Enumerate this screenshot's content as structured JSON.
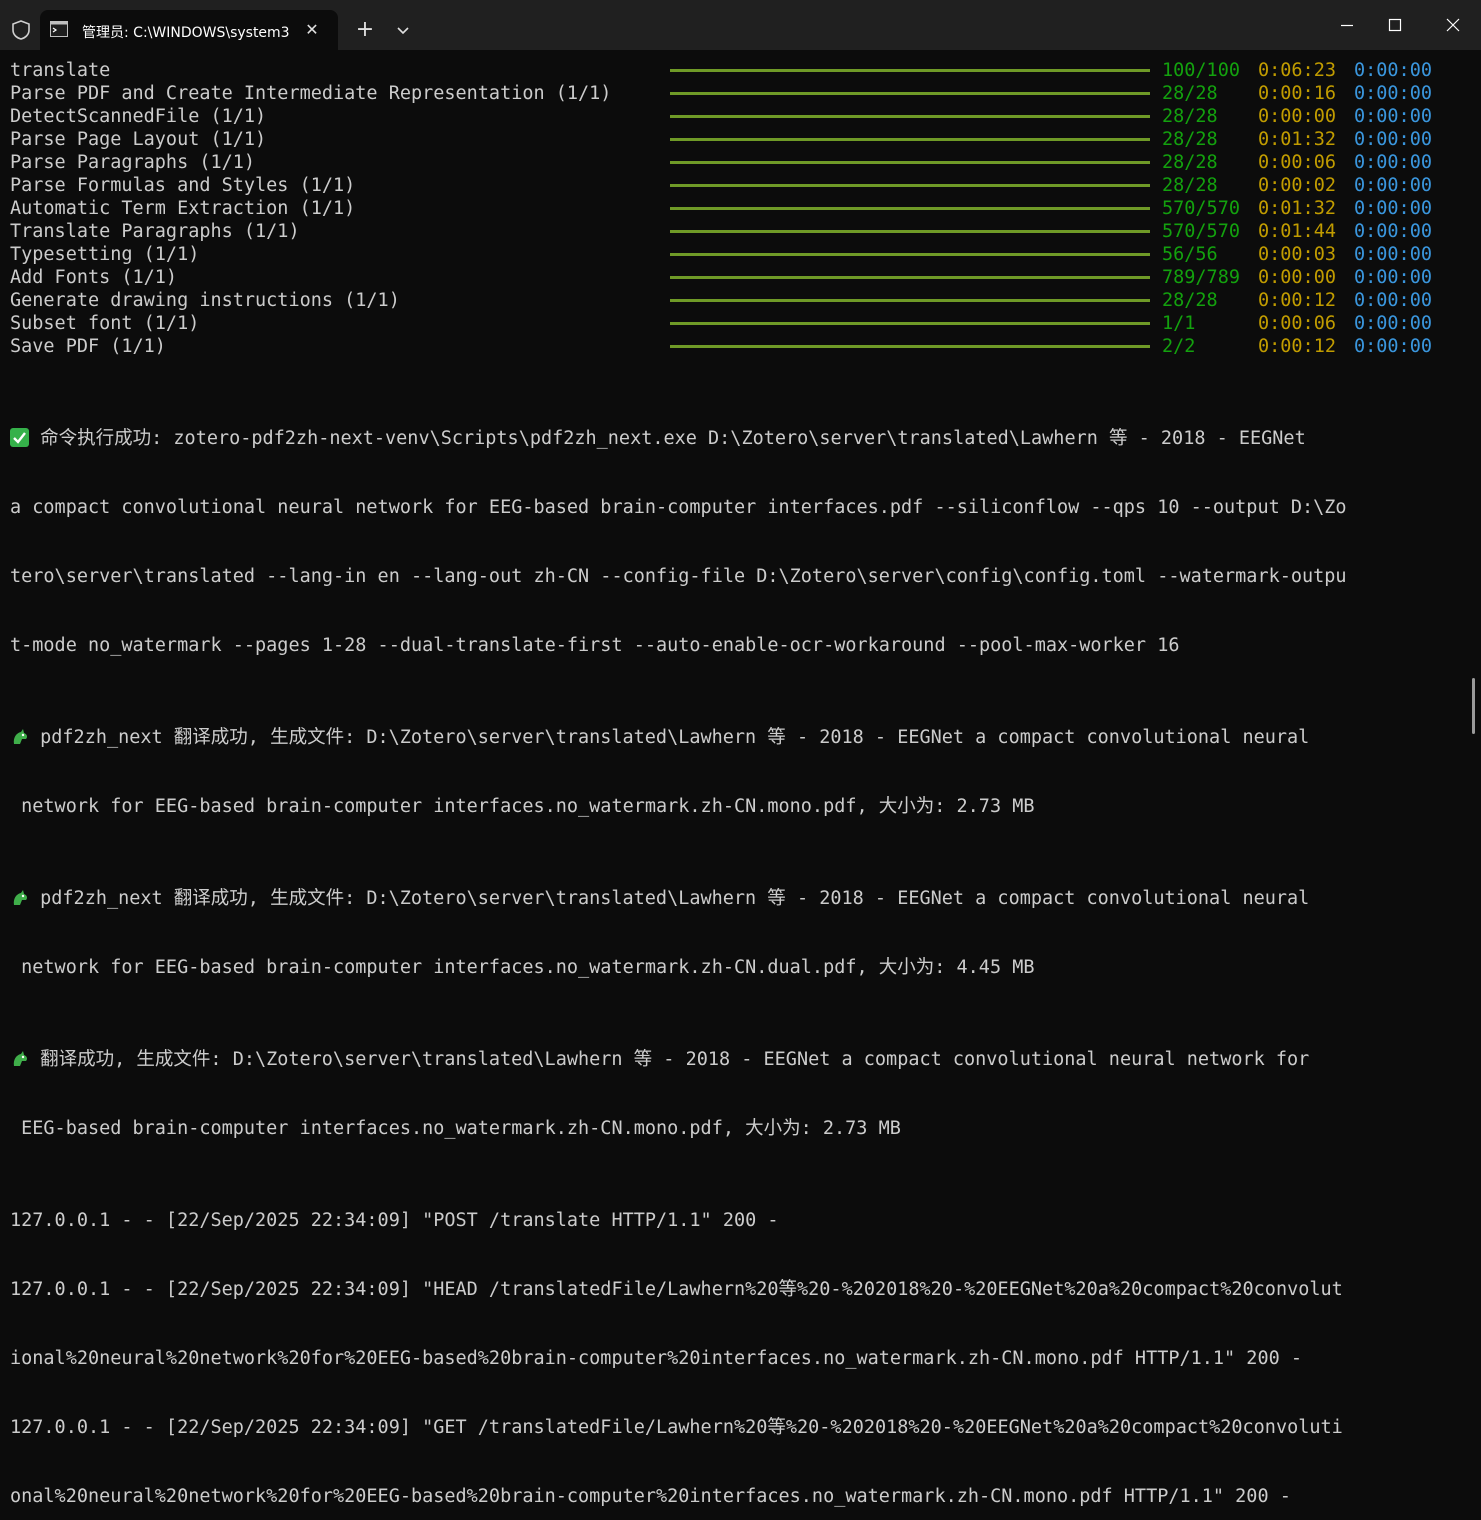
{
  "window": {
    "tab_title": "管理员: C:\\WINDOWS\\system3",
    "tab_close_glyph": "✕",
    "new_tab_glyph": "+"
  },
  "colors": {
    "progress_bar": "#6f9a27",
    "count": "#13a10e",
    "elapsed": "#c19c00",
    "remaining": "#3a96dd"
  },
  "tasks": [
    {
      "label": "translate",
      "progress": 1.0,
      "count": "100/100",
      "elapsed": "0:06:23",
      "remaining": "0:00:00"
    },
    {
      "label": "Parse PDF and Create Intermediate Representation (1/1)",
      "progress": 1.0,
      "count": "28/28",
      "elapsed": "0:00:16",
      "remaining": "0:00:00"
    },
    {
      "label": "DetectScannedFile (1/1)",
      "progress": 1.0,
      "count": "28/28",
      "elapsed": "0:00:00",
      "remaining": "0:00:00"
    },
    {
      "label": "Parse Page Layout (1/1)",
      "progress": 1.0,
      "count": "28/28",
      "elapsed": "0:01:32",
      "remaining": "0:00:00"
    },
    {
      "label": "Parse Paragraphs (1/1)",
      "progress": 1.0,
      "count": "28/28",
      "elapsed": "0:00:06",
      "remaining": "0:00:00"
    },
    {
      "label": "Parse Formulas and Styles (1/1)",
      "progress": 1.0,
      "count": "28/28",
      "elapsed": "0:00:02",
      "remaining": "0:00:00"
    },
    {
      "label": "Automatic Term Extraction (1/1)",
      "progress": 1.0,
      "count": "570/570",
      "elapsed": "0:01:32",
      "remaining": "0:00:00"
    },
    {
      "label": "Translate Paragraphs (1/1)",
      "progress": 1.0,
      "count": "570/570",
      "elapsed": "0:01:44",
      "remaining": "0:00:00"
    },
    {
      "label": "Typesetting (1/1)",
      "progress": 1.0,
      "count": "56/56",
      "elapsed": "0:00:03",
      "remaining": "0:00:00"
    },
    {
      "label": "Add Fonts (1/1)",
      "progress": 1.0,
      "count": "789/789",
      "elapsed": "0:00:00",
      "remaining": "0:00:00"
    },
    {
      "label": "Generate drawing instructions (1/1)",
      "progress": 1.0,
      "count": "28/28",
      "elapsed": "0:00:12",
      "remaining": "0:00:00"
    },
    {
      "label": "Subset font (1/1)",
      "progress": 1.0,
      "count": "1/1",
      "elapsed": "0:00:06",
      "remaining": "0:00:00"
    },
    {
      "label": "Save PDF (1/1)",
      "progress": 1.0,
      "count": "2/2",
      "elapsed": "0:00:12",
      "remaining": "0:00:00"
    }
  ],
  "log": {
    "success": [
      " 命令执行成功: zotero-pdf2zh-next-venv\\Scripts\\pdf2zh_next.exe D:\\Zotero\\server\\translated\\Lawhern 等 - 2018 - EEGNet",
      "a compact convolutional neural network for EEG-based brain-computer interfaces.pdf --siliconflow --qps 10 --output D:\\Zo",
      "tero\\server\\translated --lang-in en --lang-out zh-CN --config-file D:\\Zotero\\server\\config\\config.toml --watermark-outpu",
      "t-mode no_watermark --pages 1-28 --dual-translate-first --auto-enable-ocr-workaround --pool-max-worker 16"
    ],
    "mono": [
      " pdf2zh_next 翻译成功, 生成文件: D:\\Zotero\\server\\translated\\Lawhern 等 - 2018 - EEGNet a compact convolutional neural",
      " network for EEG-based brain-computer interfaces.no_watermark.zh-CN.mono.pdf, 大小为: 2.73 MB"
    ],
    "dual": [
      " pdf2zh_next 翻译成功, 生成文件: D:\\Zotero\\server\\translated\\Lawhern 等 - 2018 - EEGNet a compact convolutional neural",
      " network for EEG-based brain-computer interfaces.no_watermark.zh-CN.dual.pdf, 大小为: 4.45 MB"
    ],
    "final": [
      " 翻译成功, 生成文件: D:\\Zotero\\server\\translated\\Lawhern 等 - 2018 - EEGNet a compact convolutional neural network for",
      " EEG-based brain-computer interfaces.no_watermark.zh-CN.mono.pdf, 大小为: 2.73 MB"
    ],
    "http": [
      "127.0.0.1 - - [22/Sep/2025 22:34:09] \"POST /translate HTTP/1.1\" 200 -",
      "127.0.0.1 - - [22/Sep/2025 22:34:09] \"HEAD /translatedFile/Lawhern%20等%20-%202018%20-%20EEGNet%20a%20compact%20convolut",
      "ional%20neural%20network%20for%20EEG-based%20brain-computer%20interfaces.no_watermark.zh-CN.mono.pdf HTTP/1.1\" 200 -",
      "127.0.0.1 - - [22/Sep/2025 22:34:09] \"GET /translatedFile/Lawhern%20等%20-%202018%20-%20EEGNet%20a%20compact%20convoluti",
      "onal%20neural%20network%20for%20EEG-based%20brain-computer%20interfaces.no_watermark.zh-CN.mono.pdf HTTP/1.1\" 200 -"
    ]
  }
}
